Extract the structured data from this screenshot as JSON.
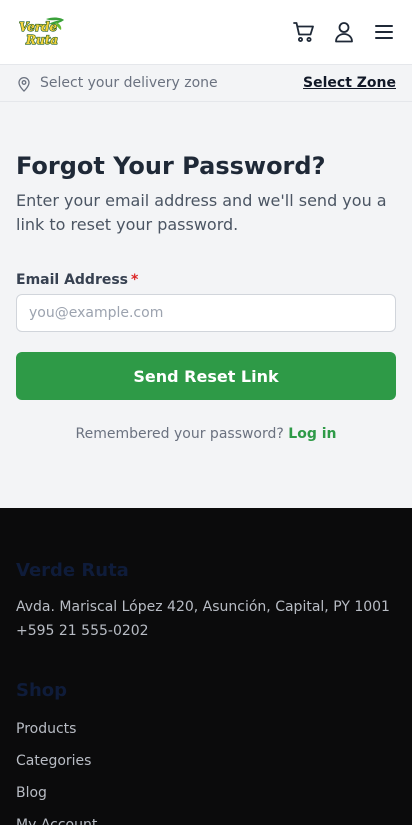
{
  "header": {
    "logo_text": "Verde Ruta",
    "icons": {
      "cart": "cart-icon",
      "account": "user-icon",
      "menu": "hamburger-menu-icon"
    }
  },
  "zone_bar": {
    "icon": "map-pin-icon",
    "prompt": "Select your delivery zone",
    "action": "Select Zone"
  },
  "form": {
    "title": "Forgot Your Password?",
    "description": "Enter your email address and we'll send you a link to reset your password.",
    "email_label": "Email Address",
    "required_mark": "*",
    "email_placeholder": "you@example.com",
    "email_value": "",
    "submit_label": "Send Reset Link",
    "remember_text": "Remembered your password?",
    "login_link": "Log in"
  },
  "footer": {
    "brand": "Verde Ruta",
    "address": "Avda. Mariscal López 420, Asunción, Capital, PY 1001",
    "phone": "+595 21 555-0202",
    "shop_heading": "Shop",
    "shop_links": [
      "Products",
      "Categories",
      "Blog",
      "My Account"
    ]
  },
  "colors": {
    "brand_green": "#2e9a47",
    "required_red": "#dc2626",
    "footer_bg": "#0b0b0c"
  }
}
